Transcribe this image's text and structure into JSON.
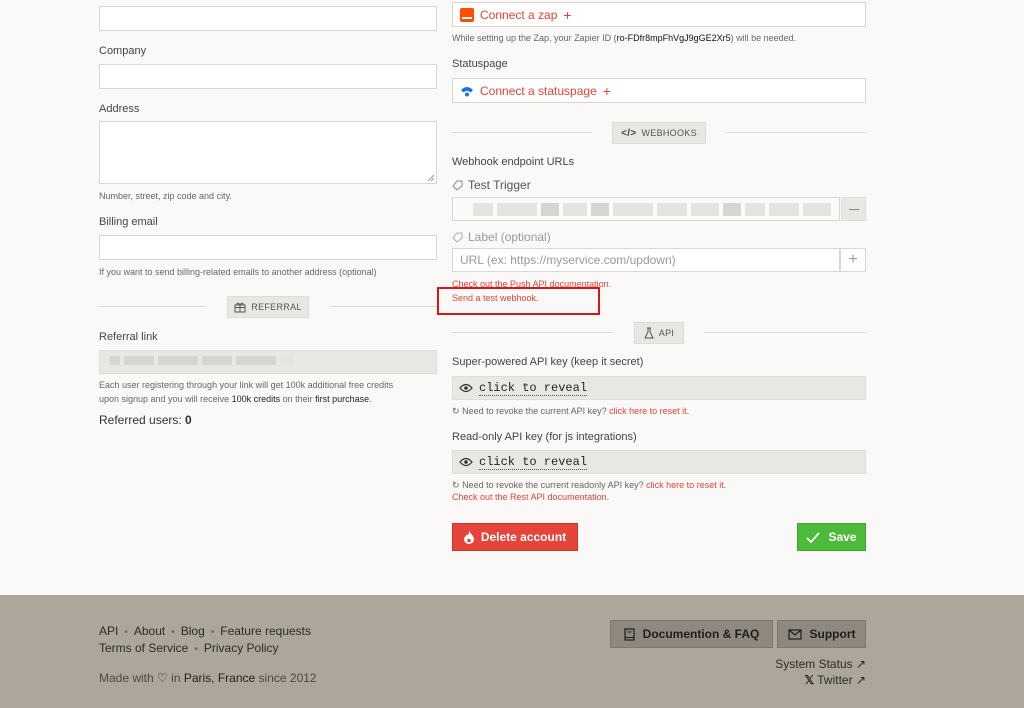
{
  "left": {
    "company_label": "Company",
    "address_label": "Address",
    "address_help": "Number, street, zip code and city.",
    "billing_label": "Billing email",
    "billing_help": "If you want to send billing-related emails to another address (optional)",
    "referral_chip": "REFERRAL",
    "referral_link_label": "Referral link",
    "referral_help_1": "Each user registering through your link will get 100k additional free credits",
    "referral_help_2a": "upon signup and you will receive ",
    "referral_help_2b": "100k credits",
    "referral_help_2c": " on their ",
    "referral_help_2d": "first purchase",
    "referral_help_2e": ".",
    "referred_users_label": "Referred users:",
    "referred_users_count": "0"
  },
  "right": {
    "zap_label": "Connect a zap",
    "zap_help_a": "While setting up the Zap, your Zapier ID (",
    "zap_id": "ro-FDfr8mpFhVgJ9gGE2Xr5",
    "zap_help_b": ") will be needed.",
    "statuspage_label": "Statuspage",
    "statuspage_connect": "Connect a statuspage",
    "webhooks_chip": "WEBHOOKS",
    "webhook_urls_label": "Webhook endpoint URLs",
    "test_trigger_label": "Test Trigger",
    "label_placeholder": "Label (optional)",
    "url_placeholder": "URL (ex: https://myservice.com/updown)",
    "push_doc_link": "Check out the Push API documentation.",
    "test_webhook_link": "Send a test webhook.",
    "api_chip": "API",
    "api_key_label": "Super-powered API key (keep it secret)",
    "click_to_reveal": "click to reveal",
    "revoke_api_a": "Need to revoke the current API key? ",
    "revoke_api_link": "click here to reset it.",
    "readonly_label": "Read-only API key (for js integrations)",
    "click_to_reveal_2": "click to reveal",
    "revoke_ro_a": "Need to revoke the current readonly API key? ",
    "revoke_ro_link": "click here to reset it.",
    "rest_doc_link": "Check out the Rest API documentation.",
    "delete_label": "Delete account",
    "save_label": "Save"
  },
  "footer": {
    "links_row1": [
      "API",
      "About",
      "Blog",
      "Feature requests"
    ],
    "links_row2": [
      "Terms of Service",
      "Privacy Policy"
    ],
    "made_with": "Made with",
    "in_text": "in",
    "city": "Paris, France",
    "since": "since 2012",
    "doc_button": "Documention & FAQ",
    "support_button": "Support",
    "system_status": "System Status ↗",
    "twitter": "Twitter ↗"
  },
  "colors": {
    "accent_red": "#e0453a",
    "save_green": "#4cbb3a",
    "highlight_box": "#d0191b",
    "footer_bg": "#ada69b"
  }
}
